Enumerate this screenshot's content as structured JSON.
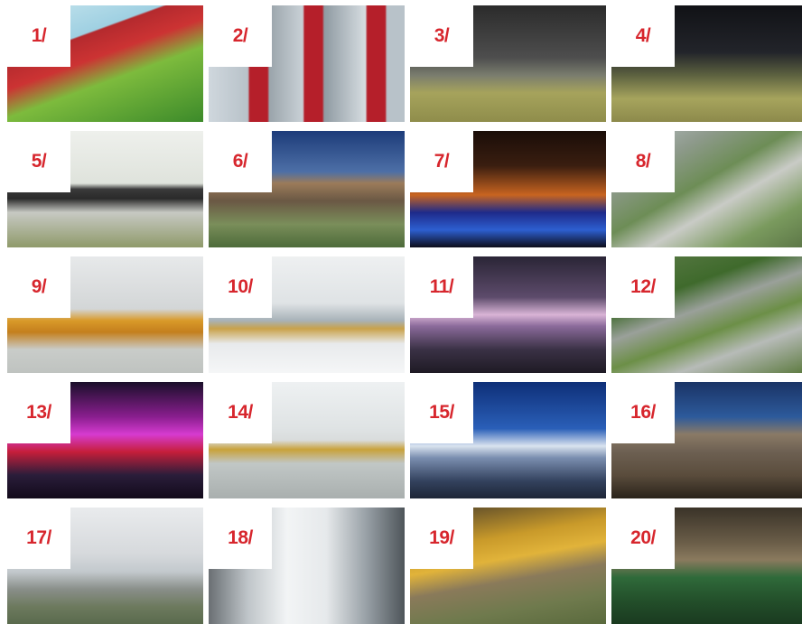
{
  "gallery": {
    "tiles": [
      {
        "label": "1/"
      },
      {
        "label": "2/"
      },
      {
        "label": "3/"
      },
      {
        "label": "4/"
      },
      {
        "label": "5/"
      },
      {
        "label": "6/"
      },
      {
        "label": "7/"
      },
      {
        "label": "8/"
      },
      {
        "label": "9/"
      },
      {
        "label": "10/"
      },
      {
        "label": "11/"
      },
      {
        "label": "12/"
      },
      {
        "label": "13/"
      },
      {
        "label": "14/"
      },
      {
        "label": "15/"
      },
      {
        "label": "16/"
      },
      {
        "label": "17/"
      },
      {
        "label": "18/"
      },
      {
        "label": "19/"
      },
      {
        "label": "20/"
      }
    ]
  },
  "colors": {
    "label_text": "#d7262d",
    "label_bg": "#ffffff",
    "page_bg": "#ffffff"
  }
}
